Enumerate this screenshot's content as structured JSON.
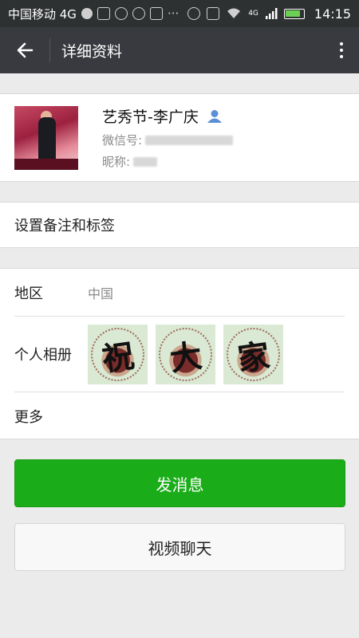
{
  "status_bar": {
    "carrier": "中国移动 4G",
    "network_label": "4G",
    "time": "14:15"
  },
  "header": {
    "title": "详细资料",
    "back_icon": "back-arrow-icon",
    "more_icon": "more-vertical-icon"
  },
  "profile": {
    "name": "艺秀节-李广庆",
    "wechat_id_label": "微信号:",
    "nickname_label": "昵称:"
  },
  "remark": {
    "label": "设置备注和标签"
  },
  "details": {
    "region_label": "地区",
    "region_value": "中国",
    "album_label": "个人相册",
    "album_images": [
      "祝",
      "大",
      "家"
    ],
    "more_label": "更多"
  },
  "actions": {
    "send_message": "发消息",
    "video_call": "视频聊天"
  },
  "colors": {
    "primary_green": "#1aad19",
    "titlebar": "#393a3f",
    "statusbar": "#2e3132"
  }
}
